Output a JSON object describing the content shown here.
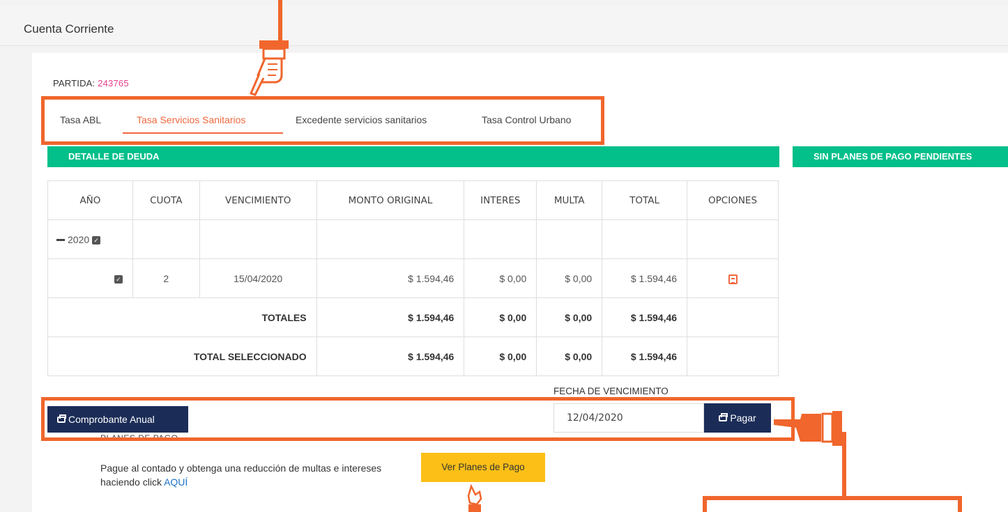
{
  "page": {
    "title": "Cuenta Corriente"
  },
  "partida": {
    "label": "PARTIDA:",
    "value": "243765"
  },
  "tabs": [
    {
      "label": "Tasa ABL"
    },
    {
      "label": "Tasa Servicios Sanitarios",
      "active": true
    },
    {
      "label": "Excedente servicios sanitarios"
    },
    {
      "label": "Tasa Control Urbano"
    }
  ],
  "detalle": {
    "title": "DETALLE DE DEUDA"
  },
  "planes_pendientes": {
    "title": "SIN PLANES DE PAGO PENDIENTES"
  },
  "table": {
    "headers": [
      "AÑO",
      "CUOTA",
      "VENCIMIENTO",
      "MONTO ORIGINAL",
      "INTERES",
      "MULTA",
      "TOTAL",
      "OPCIONES"
    ],
    "year_row": {
      "year": "2020"
    },
    "rows": [
      {
        "cuota": "2",
        "vencimiento": "15/04/2020",
        "monto_original": "$ 1.594,46",
        "interes": "$ 0,00",
        "multa": "$ 0,00",
        "total": "$ 1.594,46"
      }
    ],
    "totales": {
      "label": "TOTALES",
      "monto_original": "$ 1.594,46",
      "interes": "$ 0,00",
      "multa": "$ 0,00",
      "total": "$ 1.594,46"
    },
    "total_seleccionado": {
      "label": "TOTAL SELECCIONADO",
      "monto_original": "$ 1.594,46",
      "interes": "$ 0,00",
      "multa": "$ 0,00",
      "total": "$ 1.594,46"
    }
  },
  "actions": {
    "comprobante_label": "Comprobante Anual",
    "fecha_label": "FECHA DE VENCIMIENTO",
    "fecha_value": "12/04/2020",
    "pagar_label": "Pagar"
  },
  "planes": {
    "section_label": "PLANES DE PAGO",
    "text": "Pague al contado y obtenga una reducción de multas e intereses haciendo click",
    "link": "AQUÍ",
    "button_label": "Ver Planes de Pago"
  },
  "icons": {
    "checkbox": "checkbox-checked-icon",
    "collapse": "minus-icon",
    "pdf": "file-pdf-icon",
    "print": "print-icon",
    "pointer": "pointing-hand-icon"
  },
  "colors": {
    "accent_orange": "#f0683f",
    "green_bar": "#03bf8a",
    "dark_button": "#1b2d57",
    "yellow_button": "#fbbf17",
    "partida_value": "#e83e8c",
    "link": "#1a73c8"
  }
}
